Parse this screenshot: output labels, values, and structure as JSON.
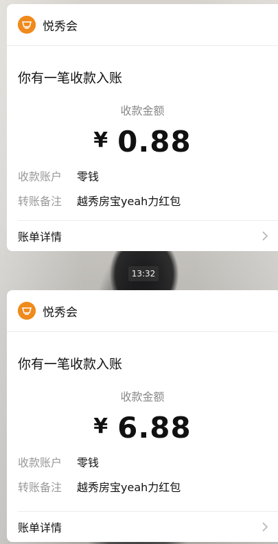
{
  "timestamp": "13:32",
  "messages": [
    {
      "org_name": "悦秀会",
      "headline": "你有一笔收款入账",
      "amount_label": "收款金额",
      "currency": "¥",
      "amount": "0.88",
      "account_key": "收款账户",
      "account_value": "零钱",
      "note_key": "转账备注",
      "note_value": "越秀房宝yeah力红包",
      "detail_label": "账单详情"
    },
    {
      "org_name": "悦秀会",
      "headline": "你有一笔收款入账",
      "amount_label": "收款金额",
      "currency": "¥",
      "amount": "6.88",
      "account_key": "收款账户",
      "account_value": "零钱",
      "note_key": "转账备注",
      "note_value": "越秀房宝yeah力红包",
      "detail_label": "账单详情"
    }
  ],
  "colors": {
    "logo": "#f08a1c",
    "muted_text": "#999999",
    "card_bg": "#ffffff"
  },
  "icons": {
    "logo": "yuexiuhui-logo-icon",
    "chevron": "chevron-right-icon"
  }
}
